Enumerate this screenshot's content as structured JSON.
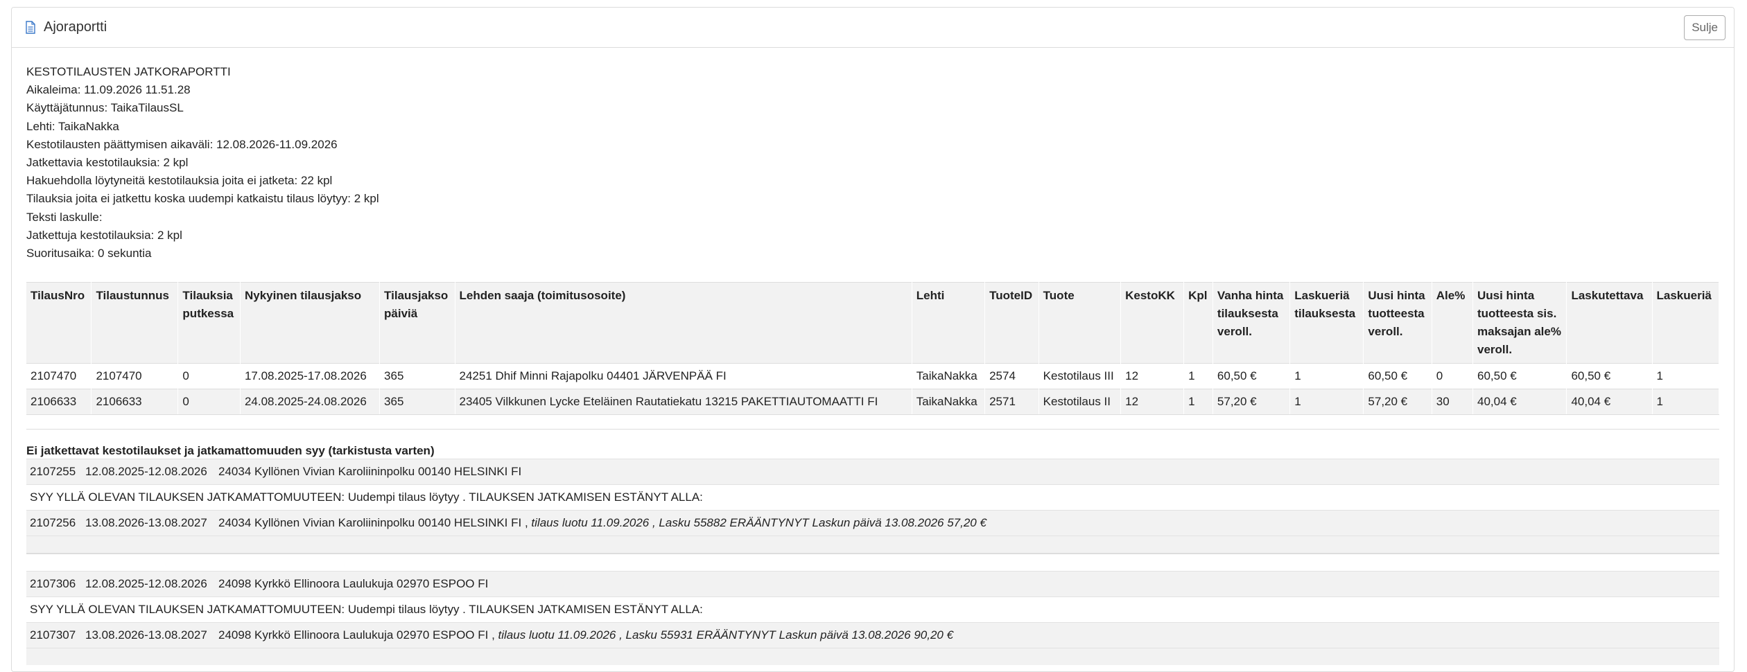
{
  "header": {
    "title": "Ajoraportti",
    "close_label": "Sulje"
  },
  "info": {
    "lines": [
      "KESTOTILAUSTEN JATKORAPORTTI",
      "Aikaleima: 11.09.2026 11.51.28",
      "Käyttäjätunnus: TaikaTilausSL",
      "Lehti: TaikaNakka",
      "Kestotilausten päättymisen aikaväli: 12.08.2026-11.09.2026",
      "Jatkettavia kestotilauksia: 2 kpl",
      "Hakuehdolla löytyneitä kestotilauksia joita ei jatketa: 22 kpl",
      "Tilauksia joita ei jatkettu koska uudempi katkaistu tilaus löytyy: 2 kpl",
      "Teksti laskulle:",
      "Jatkettuja kestotilauksia: 2 kpl",
      "Suoritusaika: 0 sekuntia"
    ]
  },
  "main_table": {
    "headers": [
      "TilausNro",
      "Tilaustunnus",
      "Tilauksia putkessa",
      "Nykyinen tilausjakso",
      "Tilausjakso päiviä",
      "Lehden saaja (toimitusosoite)",
      "Lehti",
      "TuoteID",
      "Tuote",
      "KestoKK",
      "Kpl",
      "Vanha hinta tilauksesta veroll.",
      "Laskueriä tilauksesta",
      "Uusi hinta tuotteesta veroll.",
      "Ale%",
      "Uusi hinta tuotteesta sis. maksajan ale% veroll.",
      "Laskutettava",
      "Laskueriä"
    ],
    "rows": [
      [
        "2107470",
        "2107470",
        "0",
        "17.08.2025-17.08.2026",
        "365",
        "24251 Dhif Minni Rajapolku 04401 JÄRVENPÄÄ FI",
        "TaikaNakka",
        "2574",
        "Kestotilaus III",
        "12",
        "1",
        "60,50 €",
        "1",
        "60,50 €",
        "0",
        "60,50 €",
        "60,50 €",
        "1"
      ],
      [
        "2106633",
        "2106633",
        "0",
        "24.08.2025-24.08.2026",
        "365",
        "23405 Vilkkunen Lycke Eteläinen Rautatiekatu 13215 PAKETTIAUTOMAATTI FI",
        "TaikaNakka",
        "2571",
        "Kestotilaus II",
        "12",
        "1",
        "57,20 €",
        "1",
        "57,20 €",
        "30",
        "40,04 €",
        "40,04 €",
        "1"
      ]
    ]
  },
  "skipped": {
    "title": "Ei jatkettavat kestotilaukset ja jatkamattomuuden syy (tarkistusta varten)",
    "groups": [
      {
        "orig": {
          "nro": "2107255",
          "period": "12.08.2025-12.08.2026",
          "recipient": "24034 Kyllönen Vivian Karoliininpolku 00140 HELSINKI FI"
        },
        "reason": "SYY YLLÄ OLEVAN TILAUKSEN JATKAMATTOMUUTEEN: Uudempi tilaus löytyy . TILAUKSEN JATKAMISEN ESTÄNYT ALLA:",
        "blocking": {
          "nro": "2107256",
          "period": "13.08.2026-13.08.2027",
          "recipient": "24034 Kyllönen Vivian Karoliininpolku 00140 HELSINKI FI ,",
          "note": "tilaus luotu 11.09.2026 , Lasku 55882 ERÄÄNTYNYT Laskun päivä 13.08.2026 57,20 €"
        }
      },
      {
        "orig": {
          "nro": "2107306",
          "period": "12.08.2025-12.08.2026",
          "recipient": "24098 Kyrkkö Ellinoora Laulukuja 02970 ESPOO FI"
        },
        "reason": "SYY YLLÄ OLEVAN TILAUKSEN JATKAMATTOMUUTEEN: Uudempi tilaus löytyy . TILAUKSEN JATKAMISEN ESTÄNYT ALLA:",
        "blocking": {
          "nro": "2107307",
          "period": "13.08.2026-13.08.2027",
          "recipient": "24098 Kyrkkö Ellinoora Laulukuja 02970 ESPOO FI ,",
          "note": "tilaus luotu 11.09.2026 , Lasku 55931 ERÄÄNTYNYT Laskun päivä 13.08.2026 90,20 €"
        }
      }
    ]
  }
}
